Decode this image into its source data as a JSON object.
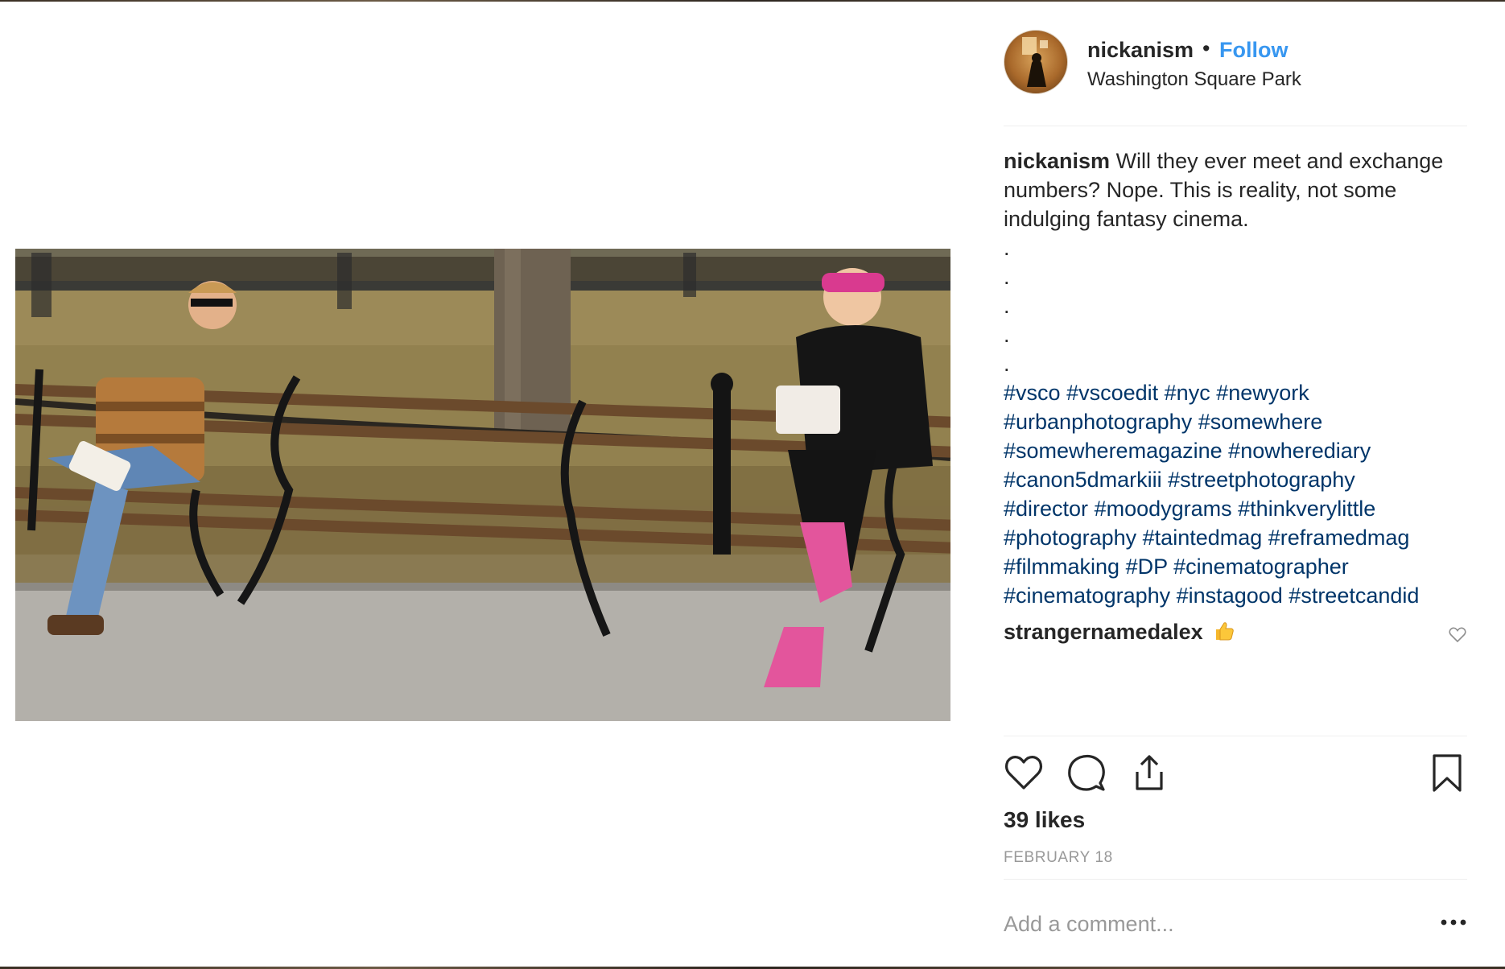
{
  "post": {
    "username": "nickanism",
    "separator": "•",
    "follow_label": "Follow",
    "location": "Washington Square Park",
    "image_subject": "street-photo-two-people-on-park-benches"
  },
  "caption": {
    "username": "nickanism",
    "text": "Will they ever meet and exchange numbers? Nope. This is reality, not some indulging fantasy cinema.",
    "dots": [
      ".",
      ".",
      ".",
      ".",
      "."
    ],
    "hashtags": [
      "#vsco",
      "#vscoedit",
      "#nyc",
      "#newyork",
      "#urbanphotography",
      "#somewhere",
      "#somewheremagazine",
      "#nowherediary",
      "#canon5dmarkiii",
      "#streetphotography",
      "#director",
      "#moodygrams",
      "#thinkverylittle",
      "#photography",
      "#taintedmag",
      "#reframedmag",
      "#filmmaking",
      "#DP",
      "#cinematographer",
      "#cinematography",
      "#instagood",
      "#streetcandid"
    ]
  },
  "comments": [
    {
      "username": "strangernamedalex",
      "emoji_icon": "thumbs-up-icon"
    }
  ],
  "stats": {
    "likes": "39 likes",
    "date": "FEBRUARY 18"
  },
  "comment_box": {
    "placeholder": "Add a comment..."
  },
  "icons": {
    "like": "heart-icon",
    "comment": "comment-bubble-icon",
    "share": "share-icon",
    "save": "bookmark-icon",
    "more": "more-options-icon"
  },
  "colors": {
    "follow": "#3897f0",
    "hashtag": "#003569",
    "muted": "#999999",
    "text": "#262626",
    "divider": "#efefef"
  }
}
